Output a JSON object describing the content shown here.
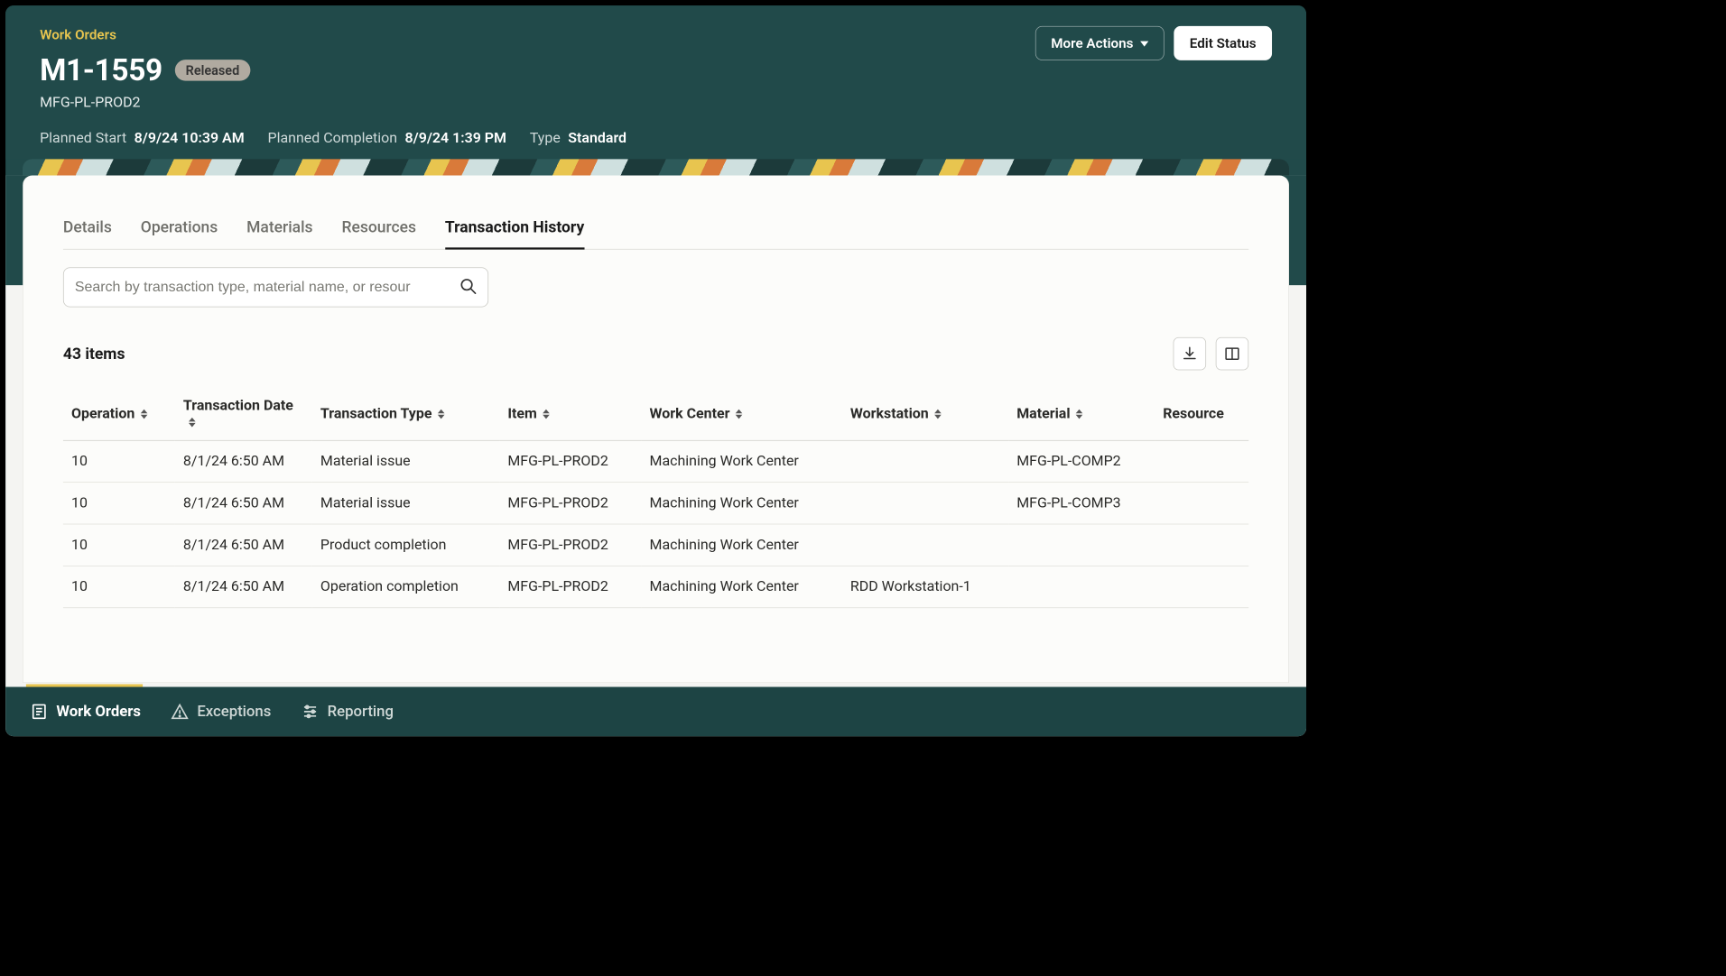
{
  "header": {
    "breadcrumb": "Work Orders",
    "title": "M1-1559",
    "status_badge": "Released",
    "subtitle": "MFG-PL-PROD2",
    "meta": {
      "planned_start_label": "Planned Start",
      "planned_start_value": "8/9/24 10:39 AM",
      "planned_completion_label": "Planned Completion",
      "planned_completion_value": "8/9/24 1:39 PM",
      "type_label": "Type",
      "type_value": "Standard"
    },
    "actions": {
      "more_actions": "More Actions",
      "edit_status": "Edit Status"
    }
  },
  "tabs": [
    {
      "label": "Details",
      "active": false
    },
    {
      "label": "Operations",
      "active": false
    },
    {
      "label": "Materials",
      "active": false
    },
    {
      "label": "Resources",
      "active": false
    },
    {
      "label": "Transaction History",
      "active": true
    }
  ],
  "search": {
    "placeholder": "Search by transaction type, material name, or resour"
  },
  "toolbar": {
    "item_count": "43 items",
    "download_icon": "download-icon",
    "columns_icon": "columns-icon"
  },
  "table": {
    "columns": [
      "Operation",
      "Transaction Date",
      "Transaction Type",
      "Item",
      "Work Center",
      "Workstation",
      "Material",
      "Resource"
    ],
    "rows": [
      {
        "operation": "10",
        "date": "8/1/24 6:50 AM",
        "type": "Material issue",
        "item": "MFG-PL-PROD2",
        "work_center": "Machining Work Center",
        "workstation": "",
        "material": "MFG-PL-COMP2",
        "resource": ""
      },
      {
        "operation": "10",
        "date": "8/1/24 6:50 AM",
        "type": "Material issue",
        "item": "MFG-PL-PROD2",
        "work_center": "Machining Work Center",
        "workstation": "",
        "material": "MFG-PL-COMP3",
        "resource": ""
      },
      {
        "operation": "10",
        "date": "8/1/24 6:50 AM",
        "type": "Product completion",
        "item": "MFG-PL-PROD2",
        "work_center": "Machining Work Center",
        "workstation": "",
        "material": "",
        "resource": ""
      },
      {
        "operation": "10",
        "date": "8/1/24 6:50 AM",
        "type": "Operation completion",
        "item": "MFG-PL-PROD2",
        "work_center": "Machining Work Center",
        "workstation": "RDD Workstation-1",
        "material": "",
        "resource": ""
      }
    ]
  },
  "bottom_nav": {
    "work_orders": "Work Orders",
    "exceptions": "Exceptions",
    "reporting": "Reporting"
  }
}
